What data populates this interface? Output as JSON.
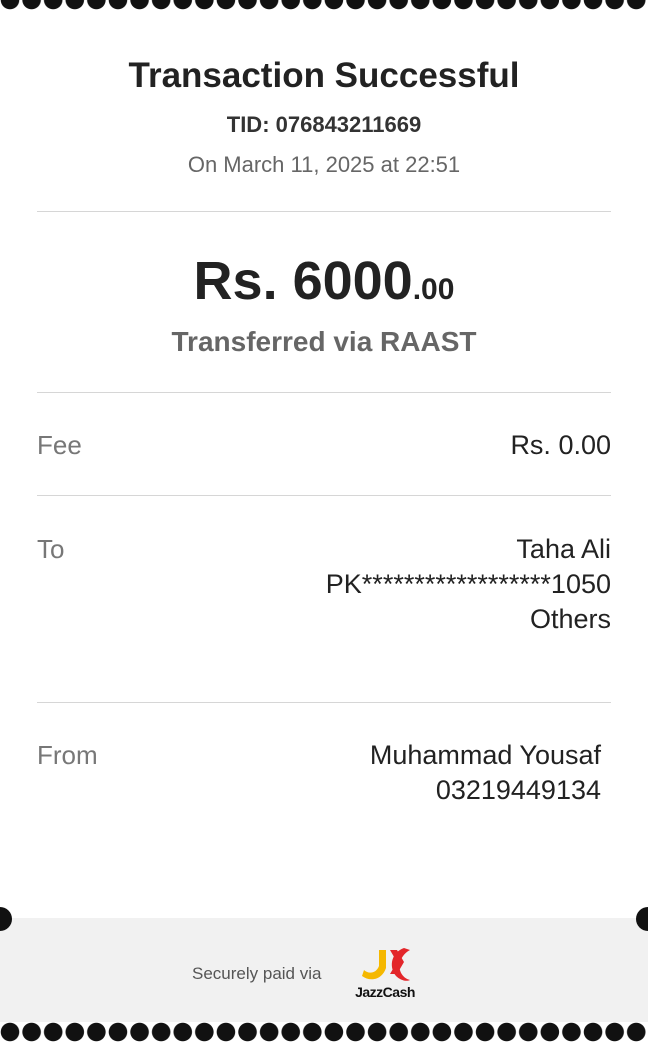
{
  "header": {
    "title": "Transaction Successful",
    "tid": "TID: 076843211669",
    "date": "On March 11, 2025 at 22:51"
  },
  "amount": {
    "main": "Rs. 6000",
    "decimal": ".00",
    "method": "Transferred via RAAST"
  },
  "fee": {
    "label": "Fee",
    "value": "Rs. 0.00"
  },
  "to": {
    "label": "To",
    "name": "Taha Ali",
    "account": "PK******************1050",
    "bank": "Others"
  },
  "from": {
    "label": "From",
    "name": "Muhammad Yousaf",
    "number": "03219449134"
  },
  "footer": {
    "secure_text": "Securely paid via",
    "brand": "JazzCash",
    "brand_colors": {
      "yellow": "#f5b800",
      "red": "#e3262a"
    }
  }
}
